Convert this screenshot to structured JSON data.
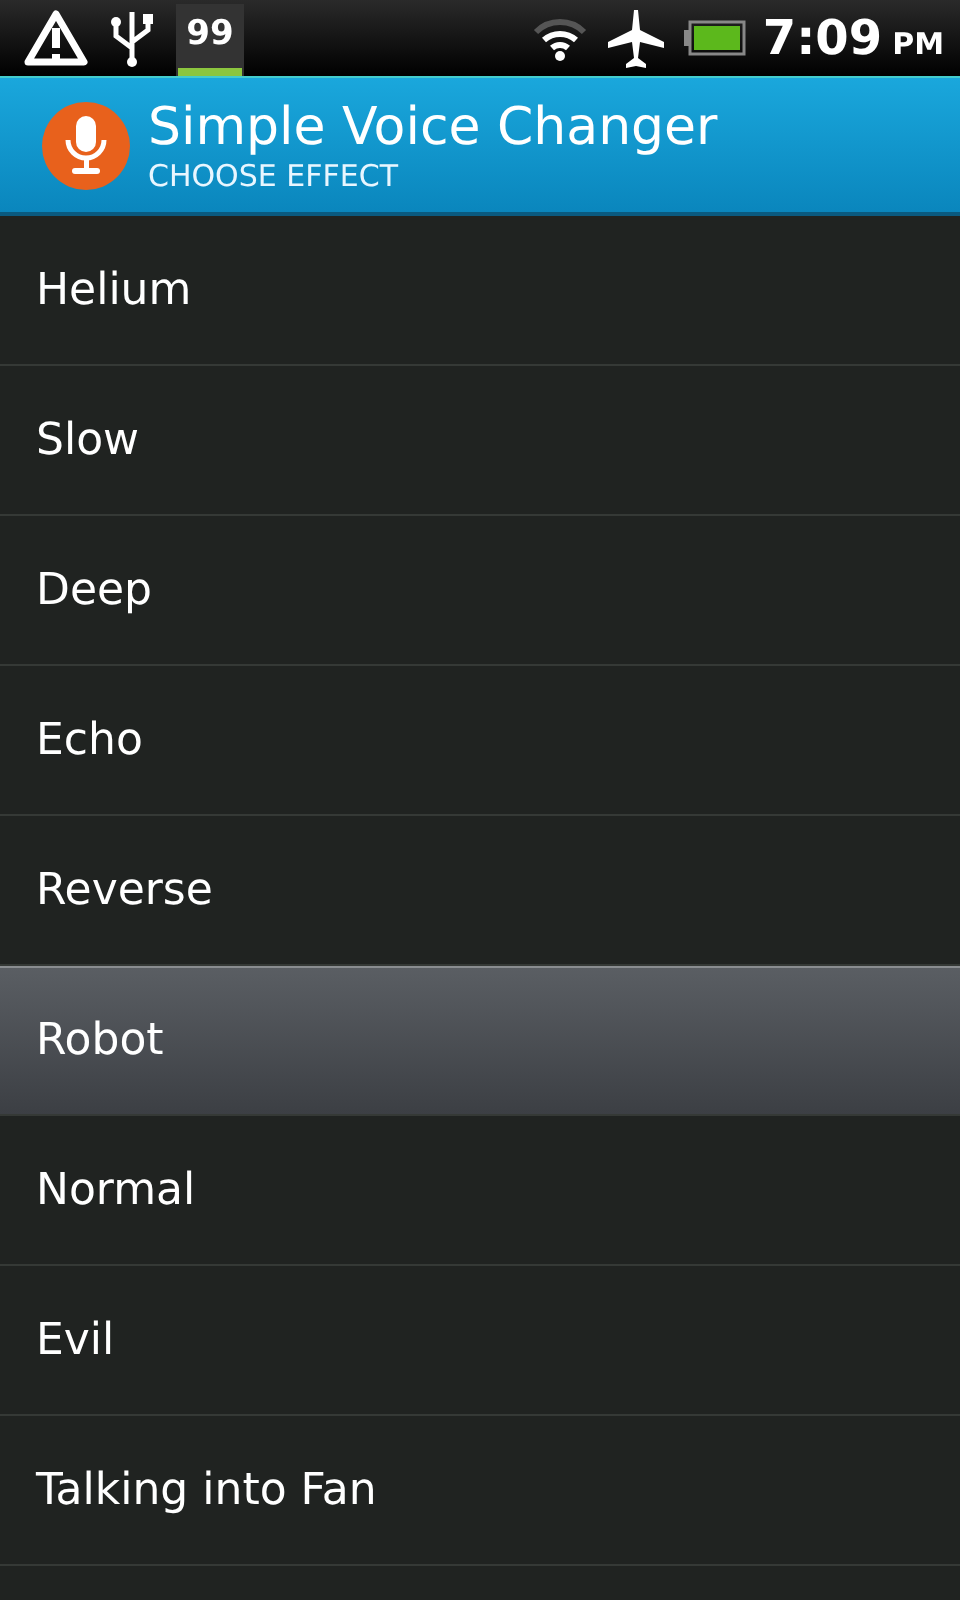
{
  "status_bar": {
    "badge": "99",
    "time": "7:09",
    "meridiem": "PM"
  },
  "app_bar": {
    "title": "Simple Voice Changer",
    "subtitle": "CHOOSE EFFECT"
  },
  "effects": [
    {
      "label": "Helium",
      "selected": false
    },
    {
      "label": "Slow",
      "selected": false
    },
    {
      "label": "Deep",
      "selected": false
    },
    {
      "label": "Echo",
      "selected": false
    },
    {
      "label": "Reverse",
      "selected": false
    },
    {
      "label": "Robot",
      "selected": true
    },
    {
      "label": "Normal",
      "selected": false
    },
    {
      "label": "Evil",
      "selected": false
    },
    {
      "label": "Talking into Fan",
      "selected": false
    }
  ]
}
